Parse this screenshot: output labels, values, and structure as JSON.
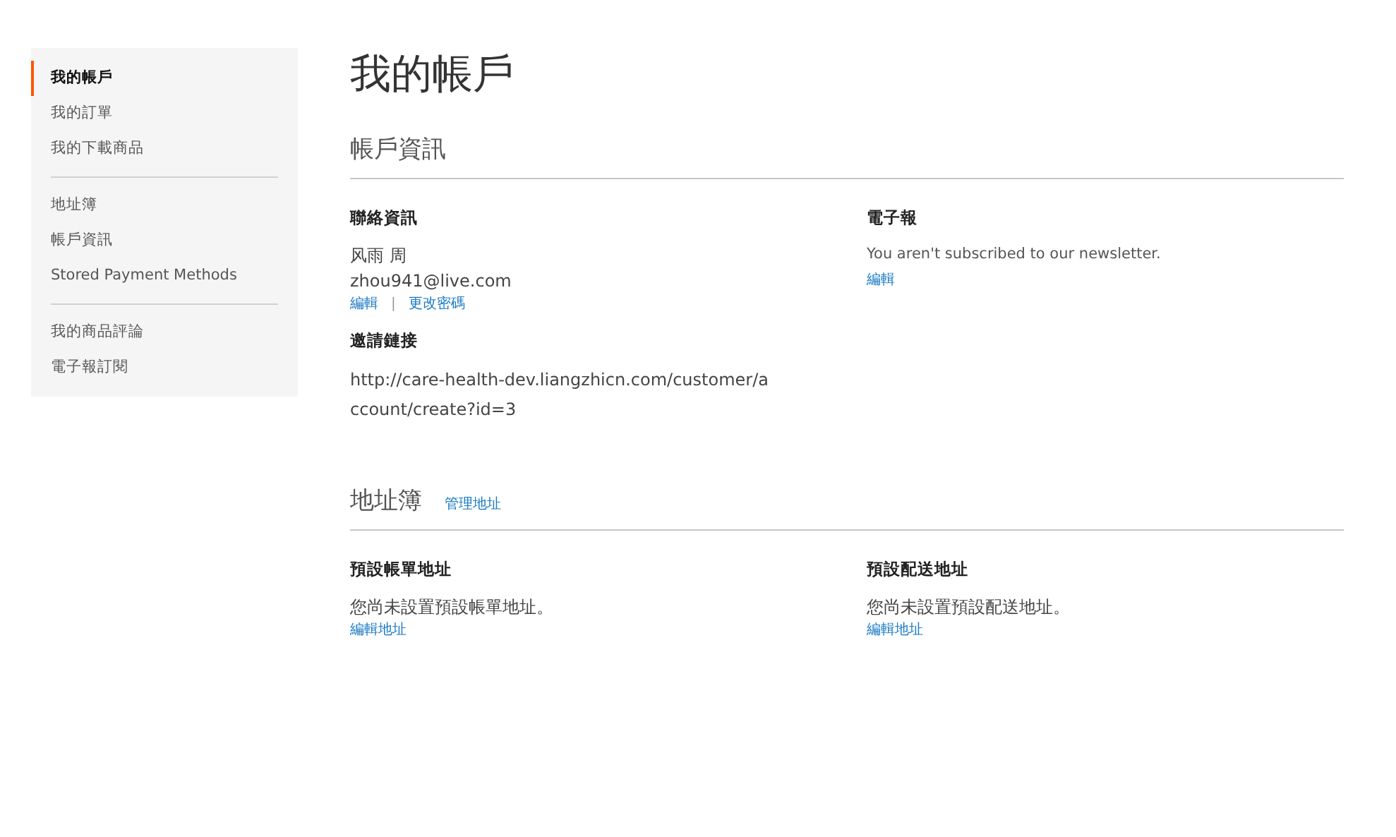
{
  "sidebar": {
    "groups": [
      [
        {
          "label": "我的帳戶",
          "selected": true
        },
        {
          "label": "我的訂單",
          "selected": false
        },
        {
          "label": "我的下載商品",
          "selected": false
        }
      ],
      [
        {
          "label": "地址簿",
          "selected": false
        },
        {
          "label": "帳戶資訊",
          "selected": false
        },
        {
          "label": "Stored Payment Methods",
          "selected": false
        }
      ],
      [
        {
          "label": "我的商品評論",
          "selected": false
        },
        {
          "label": "電子報訂閱",
          "selected": false
        }
      ]
    ]
  },
  "page_title": "我的帳戶",
  "account_info": {
    "title": "帳戶資訊",
    "contact": {
      "title": "聯絡資訊",
      "name": "风雨 周",
      "email": "zhou941@live.com",
      "edit_link": "編輯",
      "separator": "|",
      "password_link": "更改密碼"
    },
    "invite": {
      "title": "邀請鏈接",
      "url": "http://care-health-dev.liangzhicn.com/customer/account/create?id=3"
    },
    "newsletter": {
      "title": "電子報",
      "text": "You aren't subscribed to our newsletter.",
      "edit_link": "編輯"
    }
  },
  "address_book": {
    "title": "地址簿",
    "manage_link": "管理地址",
    "columns": [
      {
        "title": "預設帳單地址",
        "text": "您尚未設置預設帳單地址。",
        "link": "編輯地址"
      },
      {
        "title": "預設配送地址",
        "text": "您尚未設置預設配送地址。",
        "link": "編輯地址"
      }
    ]
  }
}
